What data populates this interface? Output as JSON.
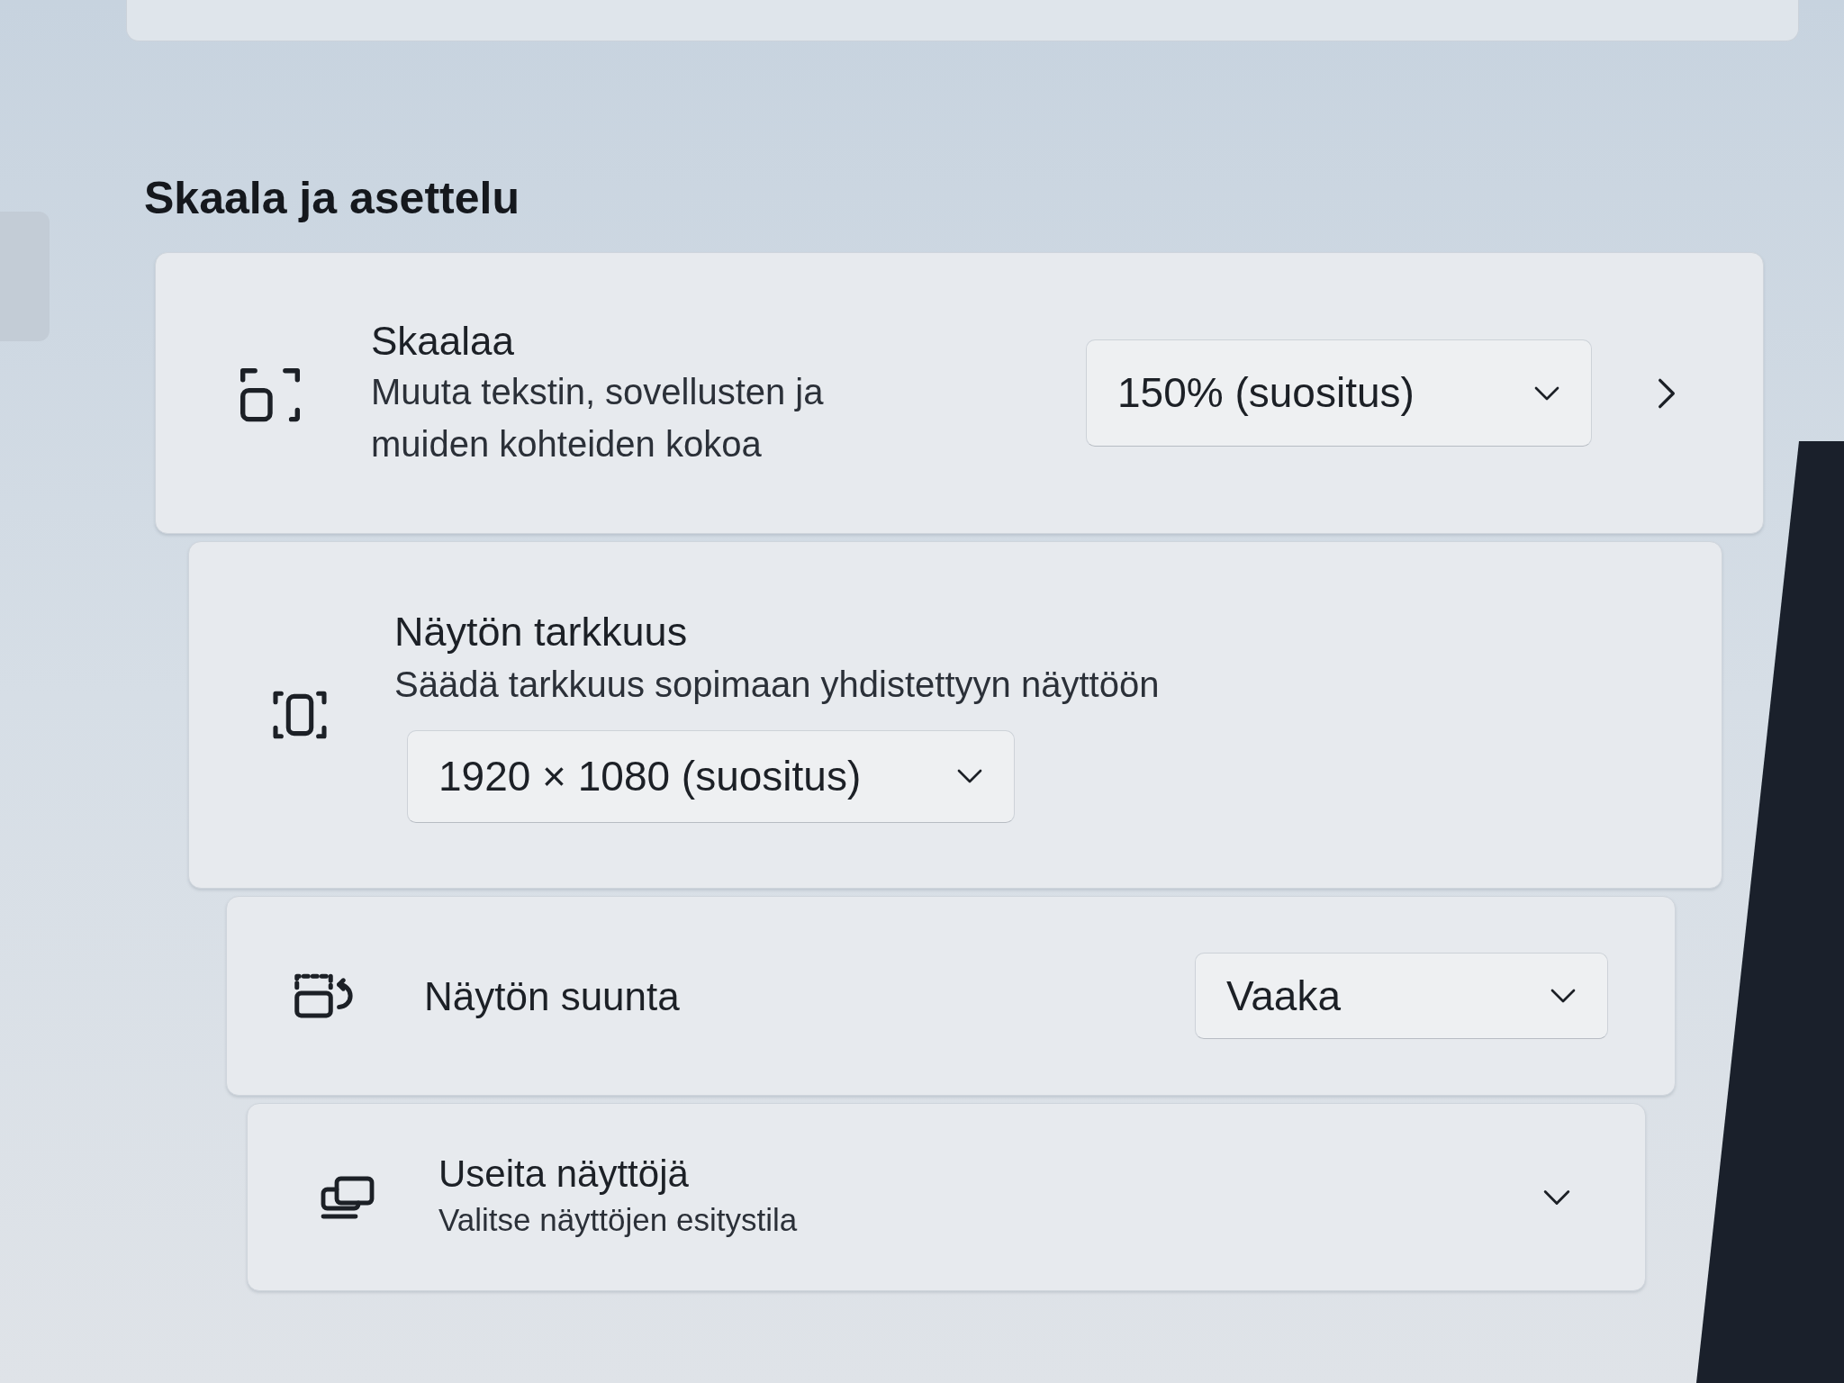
{
  "section_title": "Skaala ja asettelu",
  "settings": [
    {
      "kind": "scale",
      "title": "Skaalaa",
      "description": "Muuta tekstin, sovellusten ja muiden kohteiden kokoa",
      "value": "150% (suositus)"
    },
    {
      "kind": "resolution",
      "title": "Näytön tarkkuus",
      "description": "Säädä tarkkuus sopimaan yhdistettyyn näyttöön",
      "value": "1920 × 1080 (suositus)"
    },
    {
      "kind": "orientation",
      "title": "Näytön suunta",
      "value": "Vaaka"
    },
    {
      "kind": "multi_display",
      "title": "Useita näyttöjä",
      "description": "Valitse näyttöjen esitystila",
      "expanded": false
    }
  ]
}
